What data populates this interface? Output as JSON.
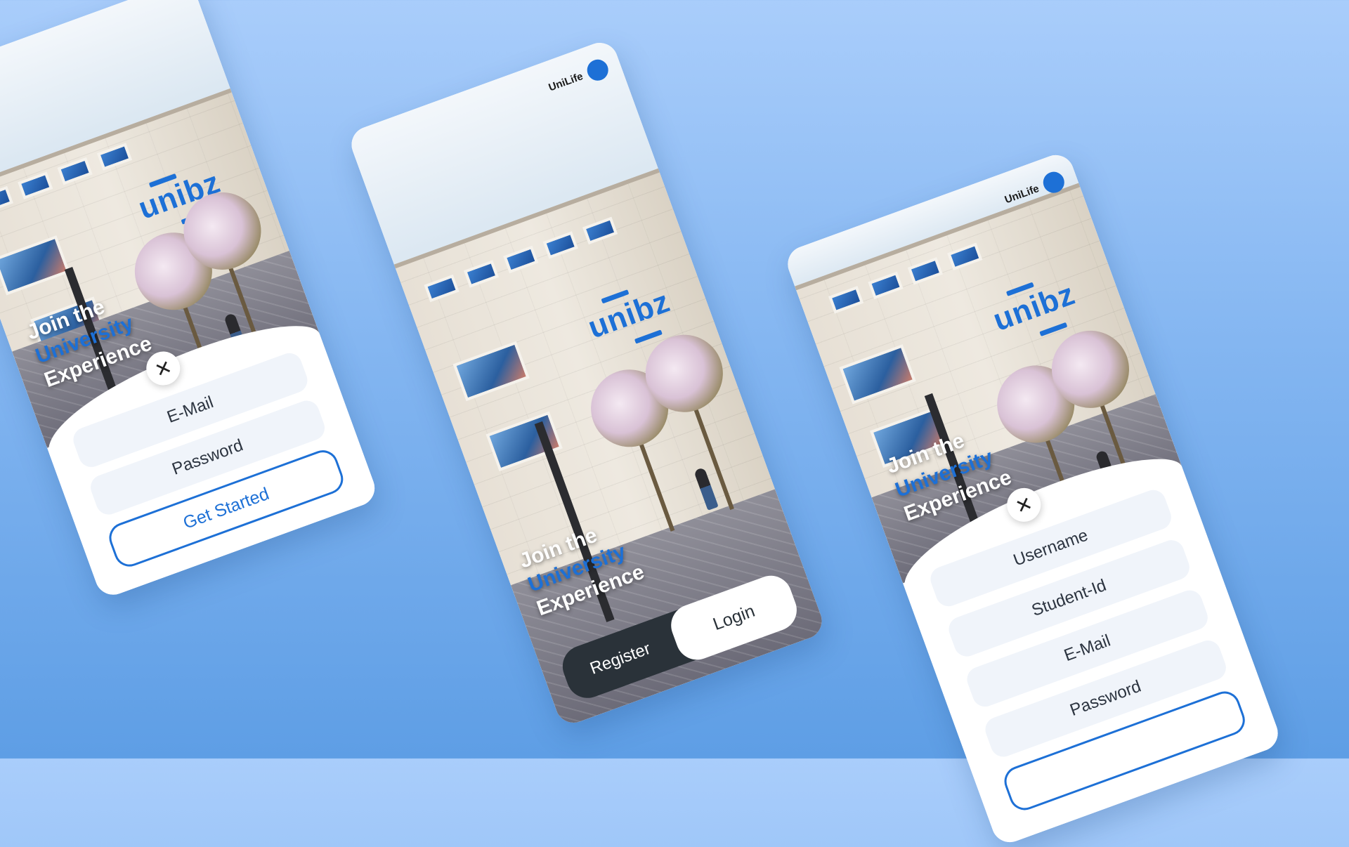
{
  "brand": {
    "name": "UniLife",
    "logo_text": "unibz"
  },
  "hero": {
    "line1": "Join the",
    "line2": "University",
    "line3": "Experience"
  },
  "login_screen": {
    "close_icon": "close-icon",
    "email_placeholder": "E-Mail",
    "password_placeholder": "Password",
    "cta_label": "Get Started"
  },
  "welcome_screen": {
    "register_label": "Register",
    "login_label": "Login"
  },
  "register_screen": {
    "close_icon": "close-icon",
    "username_placeholder": "Username",
    "student_id_placeholder": "Student-Id",
    "email_placeholder": "E-Mail",
    "password_placeholder": "Password"
  },
  "colors": {
    "accent": "#1d70d6",
    "dark": "#2a3239",
    "field": "#f0f4fa"
  }
}
